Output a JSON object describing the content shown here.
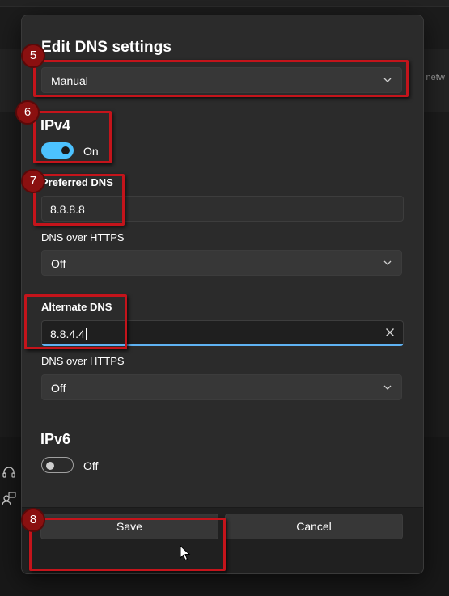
{
  "background": {
    "partial_text": "s netw"
  },
  "dialog": {
    "title": "Edit DNS settings",
    "mode_select": {
      "value": "Manual"
    },
    "ipv4": {
      "heading": "IPv4",
      "toggle_state": "On",
      "preferred_dns": {
        "label": "Preferred DNS",
        "value": "8.8.8.8"
      },
      "preferred_doh": {
        "label": "DNS over HTTPS",
        "value": "Off"
      },
      "alternate_dns": {
        "label": "Alternate DNS",
        "value": "8.8.4.4"
      },
      "alternate_doh": {
        "label": "DNS over HTTPS",
        "value": "Off"
      }
    },
    "ipv6": {
      "heading": "IPv6",
      "toggle_state": "Off"
    },
    "buttons": {
      "save": "Save",
      "cancel": "Cancel"
    }
  },
  "annotations": [
    "5",
    "6",
    "7",
    "8"
  ],
  "colors": {
    "accent": "#4cc2ff",
    "highlight": "#c4141b",
    "badge": "#8a1010",
    "dialog_bg": "#2b2b2b"
  },
  "icons": [
    "chevron-down-icon",
    "close-icon",
    "headset-icon",
    "person-feedback-icon",
    "mouse-pointer-icon"
  ]
}
